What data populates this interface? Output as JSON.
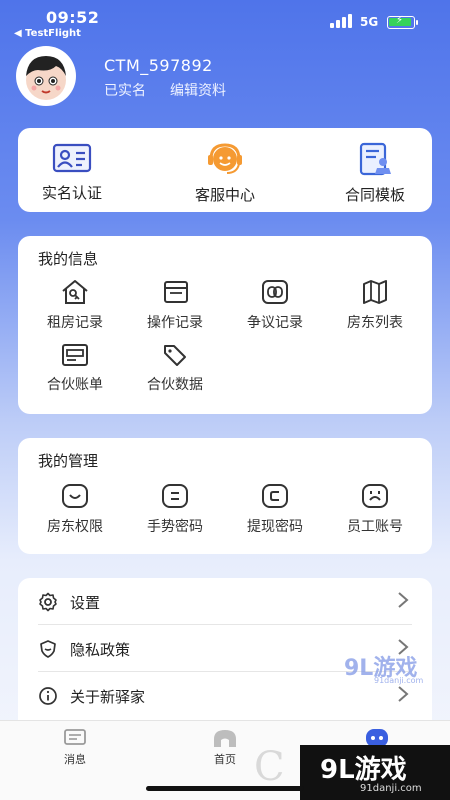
{
  "status_bar": {
    "time": "09:52",
    "back_label": "◀ TestFlight",
    "network": "5G"
  },
  "profile": {
    "username": "CTM_597892",
    "verified_label": "已实名",
    "edit_label": "编辑资料"
  },
  "quick_actions": [
    {
      "label": "实名认证",
      "icon": "id-card-icon"
    },
    {
      "label": "客服中心",
      "icon": "headset-icon"
    },
    {
      "label": "合同模板",
      "icon": "contract-icon"
    }
  ],
  "my_info": {
    "title": "我的信息",
    "items": [
      {
        "label": "租房记录",
        "icon": "house-key-icon"
      },
      {
        "label": "操作记录",
        "icon": "book-icon"
      },
      {
        "label": "争议记录",
        "icon": "dispute-icon"
      },
      {
        "label": "房东列表",
        "icon": "map-icon"
      },
      {
        "label": "合伙账单",
        "icon": "bill-icon"
      },
      {
        "label": "合伙数据",
        "icon": "tag-icon"
      }
    ]
  },
  "my_management": {
    "title": "我的管理",
    "items": [
      {
        "label": "房东权限",
        "icon": "smile-icon"
      },
      {
        "label": "手势密码",
        "icon": "gesture-icon"
      },
      {
        "label": "提现密码",
        "icon": "withdraw-icon"
      },
      {
        "label": "员工账号",
        "icon": "staff-icon"
      }
    ]
  },
  "settings_list": [
    {
      "label": "设置",
      "icon": "gear-icon"
    },
    {
      "label": "隐私政策",
      "icon": "shield-icon"
    },
    {
      "label": "关于新驿家",
      "icon": "info-icon"
    }
  ],
  "tabbar": [
    {
      "label": "消息",
      "icon": "message-icon"
    },
    {
      "label": "首页",
      "icon": "home-icon"
    },
    {
      "label": "",
      "icon": "robot-icon"
    }
  ],
  "watermark": {
    "brand": "9L游戏",
    "domain": "91danji.com"
  },
  "colors": {
    "accent": "#4f74ea",
    "icon_stroke": "#333333",
    "battery": "#36d35a"
  }
}
